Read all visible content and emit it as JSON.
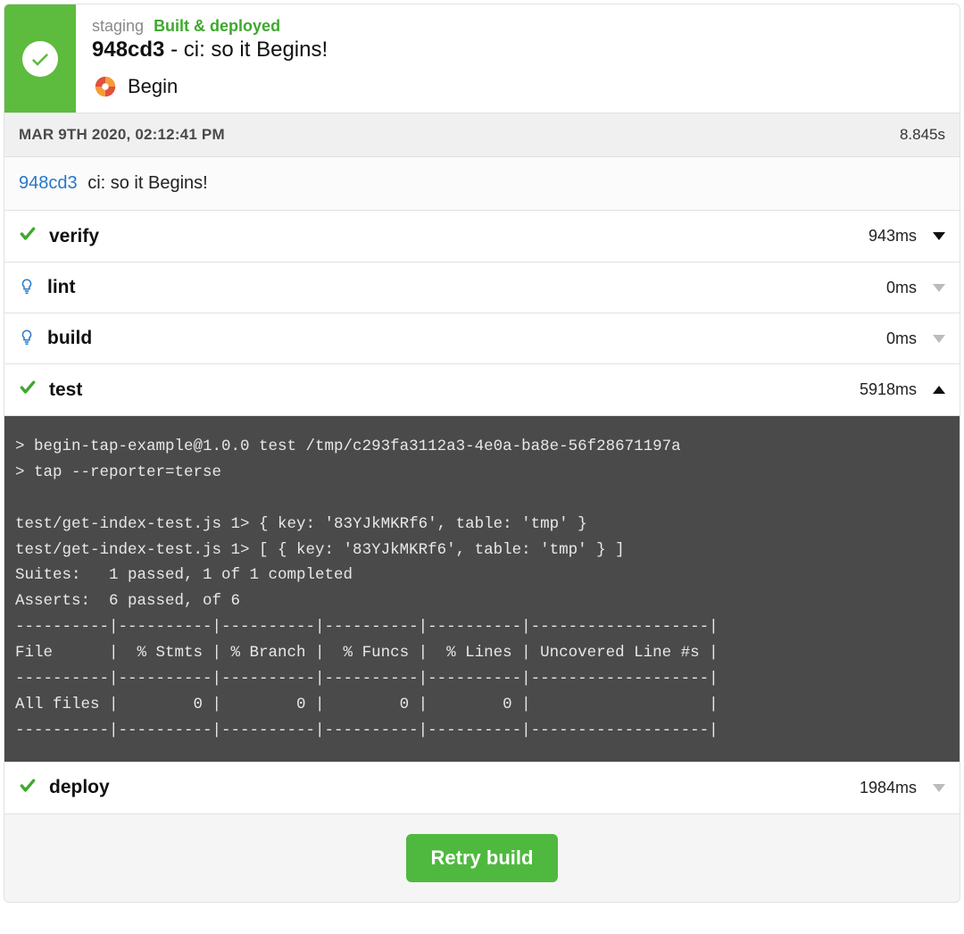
{
  "header": {
    "environment": "staging",
    "status": "Built & deployed",
    "hash": "948cd3",
    "separator": " - ",
    "commit_message": "ci: so it Begins!",
    "app_name": "Begin"
  },
  "meta": {
    "date": "MAR 9TH 2020, 02:12:41 PM",
    "total_duration": "8.845s"
  },
  "commit_row": {
    "hash_link": "948cd3",
    "message": "ci: so it Begins!"
  },
  "steps": [
    {
      "name": "verify",
      "duration": "943ms",
      "status": "success",
      "expanded": false,
      "caret": "down",
      "disabled": false
    },
    {
      "name": "lint",
      "duration": "0ms",
      "status": "info",
      "expanded": false,
      "caret": "down",
      "disabled": true
    },
    {
      "name": "build",
      "duration": "0ms",
      "status": "info",
      "expanded": false,
      "caret": "down",
      "disabled": true
    },
    {
      "name": "test",
      "duration": "5918ms",
      "status": "success",
      "expanded": true,
      "caret": "up",
      "disabled": false
    },
    {
      "name": "deploy",
      "duration": "1984ms",
      "status": "success",
      "expanded": false,
      "caret": "down",
      "disabled": true
    }
  ],
  "terminal_output": "> begin-tap-example@1.0.0 test /tmp/c293fa3112a3-4e0a-ba8e-56f28671197a\n> tap --reporter=terse\n\ntest/get-index-test.js 1> { key: '83YJkMKRf6', table: 'tmp' }\ntest/get-index-test.js 1> [ { key: '83YJkMKRf6', table: 'tmp' } ]\nSuites:   1 passed, 1 of 1 completed\nAsserts:  6 passed, of 6\n----------|----------|----------|----------|----------|-------------------|\nFile      |  % Stmts | % Branch |  % Funcs |  % Lines | Uncovered Line #s |\n----------|----------|----------|----------|----------|-------------------|\nAll files |        0 |        0 |        0 |        0 |                   |\n----------|----------|----------|----------|----------|-------------------|",
  "footer": {
    "retry_label": "Retry build"
  }
}
